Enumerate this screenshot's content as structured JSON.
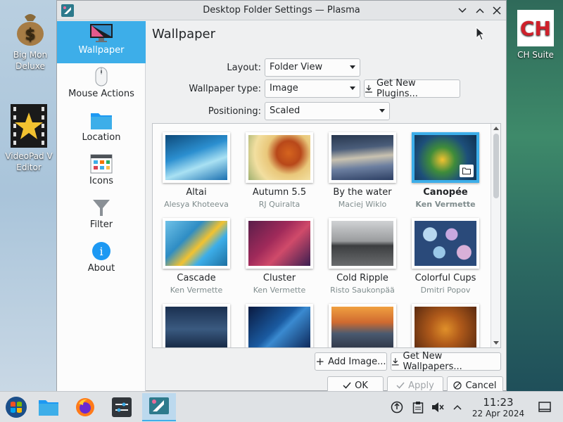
{
  "window": {
    "title": "Desktop Folder Settings — Plasma",
    "min_glyph": "﹀",
    "max_glyph": "︿",
    "close_glyph": "✕"
  },
  "desktop": {
    "icons": [
      {
        "label_line1": "Big Mon",
        "label_line2": "Deluxe"
      },
      {
        "label_line1": "VideoPad V",
        "label_line2": "Editor"
      },
      {
        "label_line1": "CH Suite",
        "label_line2": ""
      }
    ]
  },
  "sidebar": {
    "items": [
      {
        "label": "Wallpaper",
        "icon": "monitor-icon"
      },
      {
        "label": "Mouse Actions",
        "icon": "mouse-icon"
      },
      {
        "label": "Location",
        "icon": "folder-icon"
      },
      {
        "label": "Icons",
        "icon": "icons-grid-icon"
      },
      {
        "label": "Filter",
        "icon": "funnel-icon"
      },
      {
        "label": "About",
        "icon": "info-icon"
      }
    ]
  },
  "main": {
    "heading": "Wallpaper",
    "layout_label": "Layout:",
    "layout_value": "Folder View",
    "type_label": "Wallpaper type:",
    "type_value": "Image",
    "get_plugins": "Get New Plugins...",
    "positioning_label": "Positioning:",
    "positioning_value": "Scaled",
    "add_image": "Add Image...",
    "get_wallpapers": "Get New Wallpapers...",
    "ok": "OK",
    "apply": "Apply",
    "cancel": "Cancel"
  },
  "wallpapers": [
    {
      "name": "Altai",
      "author": "Alesya Khoteeva"
    },
    {
      "name": "Autumn 5.5",
      "author": "RJ Quiralta"
    },
    {
      "name": "By the water",
      "author": "Maciej Wiklo"
    },
    {
      "name": "Canopée",
      "author": "Ken Vermette",
      "selected": true
    },
    {
      "name": "Cascade",
      "author": "Ken Vermette"
    },
    {
      "name": "Cluster",
      "author": "Ken Vermette"
    },
    {
      "name": "Cold Ripple",
      "author": "Risto Saukonpää"
    },
    {
      "name": "Colorful Cups",
      "author": "Dmitri Popov"
    },
    {
      "name": "",
      "author": ""
    },
    {
      "name": "",
      "author": ""
    },
    {
      "name": "",
      "author": ""
    },
    {
      "name": "",
      "author": ""
    }
  ],
  "taskbar": {
    "time": "11:23",
    "date": "22 Apr 2024"
  }
}
